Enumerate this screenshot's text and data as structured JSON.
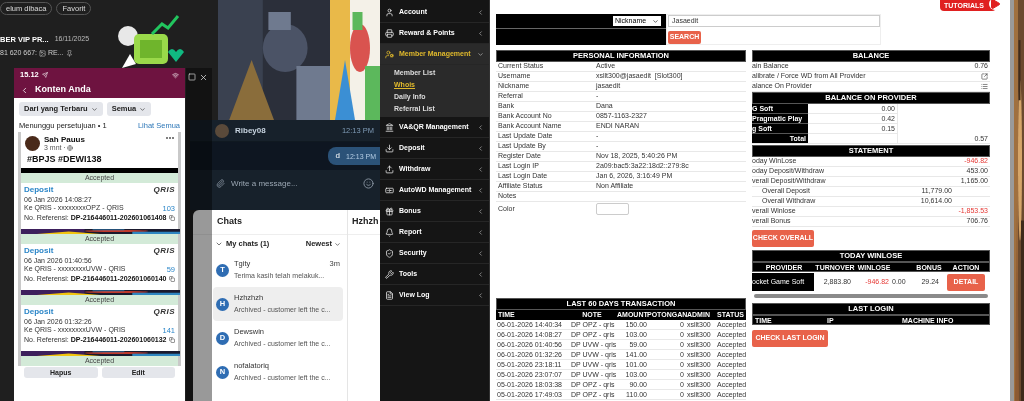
{
  "chat_list_fragment": {
    "chips": [
      "elum dibaca",
      "Favorit"
    ],
    "chat": {
      "name": "BER VIP PR...",
      "date": "16/11/2025",
      "preview_number": "81 620 667:",
      "preview_text": "RE..."
    }
  },
  "phone": {
    "time": "15.12",
    "title": "Konten Anda",
    "filters": [
      "Dari yang Terbaru",
      "Semua"
    ],
    "pending_label": "Menunggu persetujuan • 1",
    "see_all": "Lihat Semua",
    "post": {
      "author": "Sah Pauus",
      "age": "3 mnt ·",
      "text": "#BPJS #DEWI138"
    },
    "transactions": [
      {
        "status": "Accepted",
        "type": "Deposit",
        "logo": "QRIS",
        "date": "06 Jan 2026 14:08:27",
        "destination": "Ke QRIS - xxxxxxxxOPZ - QRIS",
        "amount": "103",
        "ref_label": "No. Referensi:",
        "ref": "DP-216446011-202601061408"
      },
      {
        "status": "Accepted",
        "type": "Deposit",
        "logo": "QRIS",
        "date": "06 Jan 2026 01:40:56",
        "destination": "Ke QRIS - xxxxxxxxUVW - QRIS",
        "amount": "59",
        "ref_label": "No. Referensi:",
        "ref": "DP-216446011-202601060140"
      },
      {
        "status": "Accepted",
        "type": "Deposit",
        "logo": "QRIS",
        "date": "06 Jan 2026 01:32:26",
        "destination": "Ke QRIS - xxxxxxxxUVW - QRIS",
        "amount": "141",
        "ref_label": "No. Referensi:",
        "ref": "DP-216446011-202601060132"
      }
    ],
    "last_status": "Accepted",
    "buttons": [
      "Hapus",
      "Edit"
    ]
  },
  "messenger": {
    "contact": "Ribey08",
    "time": "12:13 PM",
    "message": {
      "text": "d",
      "time": "12:13 PM"
    },
    "placeholder": "Write a message..."
  },
  "chats": {
    "title": "Chats",
    "section": "My chats (1)",
    "sort": "Newest",
    "open_chat": "Hzhzh",
    "items": [
      {
        "initial": "T",
        "name": "Tgity",
        "time": "3m",
        "preview": "Terima kasih telah melakuk...",
        "selected": false
      },
      {
        "initial": "H",
        "name": "Hzhzhzh",
        "preview": "Archived - customer left the c...",
        "selected": true
      },
      {
        "initial": "D",
        "name": "Dewswin",
        "preview": "Archived - customer left the c...",
        "selected": false
      },
      {
        "initial": "N",
        "name": "nofalatoriq",
        "preview": "Archived - customer left the c...",
        "selected": false
      }
    ]
  },
  "sidebar": {
    "items": [
      {
        "label": "Account",
        "expanded": false
      },
      {
        "label": "Reward & Points",
        "expanded": false
      },
      {
        "label": "Member Management",
        "expanded": true,
        "children": [
          {
            "label": "Member List",
            "selected": false
          },
          {
            "label": "Whois",
            "selected": true
          },
          {
            "label": "Daily Info",
            "selected": false
          },
          {
            "label": "Referral List",
            "selected": false
          }
        ]
      },
      {
        "label": "VA&QR Management",
        "expanded": false
      },
      {
        "label": "Deposit",
        "expanded": false
      },
      {
        "label": "Withdraw",
        "expanded": false
      },
      {
        "label": "AutoWD Management",
        "expanded": false
      },
      {
        "label": "Bonus",
        "expanded": false
      },
      {
        "label": "Report",
        "expanded": false
      },
      {
        "label": "Security",
        "expanded": false
      },
      {
        "label": "Tools",
        "expanded": false
      },
      {
        "label": "View Log",
        "expanded": false
      }
    ]
  },
  "tutorials_logo": "TUTORIALS",
  "search": {
    "field": "Nickname",
    "value": "Jasaedit",
    "button": "SEARCH"
  },
  "personal_information": {
    "title": "PERSONAL INFORMATION",
    "rows": [
      {
        "label": "Current Status",
        "value": "Active"
      },
      {
        "label": "Username",
        "value": "xsllt300@jasaedit  [Slot300]"
      },
      {
        "label": "Nickname",
        "value": "jasaedit"
      },
      {
        "label": "Referral",
        "value": "-"
      },
      {
        "label": "Bank",
        "value": "Dana"
      },
      {
        "label": "Bank Account No",
        "value": "0857-1163-2327"
      },
      {
        "label": "Bank Account Name",
        "value": "ENDI NARAN"
      },
      {
        "label": "Last Update Date",
        "value": "-"
      },
      {
        "label": "Last Update By",
        "value": "-"
      },
      {
        "label": "Register Date",
        "value": "Nov 18, 2025, 5:40:26 PM"
      },
      {
        "label": "Last Login IP",
        "value": "2a09:bac5:3a22:18d2::279:8c"
      },
      {
        "label": "Last Login Date",
        "value": "Jan 6, 2026, 3:16:49 PM"
      },
      {
        "label": "Affiliate Status",
        "value": "Non Affiliate"
      },
      {
        "label": "Notes"
      }
    ],
    "color_label": "Color"
  },
  "transactions": {
    "title": "LAST 60 DAYS TRANSACTION",
    "columns": [
      "TIME",
      "NOTE",
      "AMOUNT",
      "POTONGAN",
      "ADMIN",
      "STATUS"
    ],
    "rows": [
      [
        "06-01-2026 14:40:34",
        "DP OPZ - qris",
        "150.00",
        "0",
        "xsllt300",
        "Accepted"
      ],
      [
        "06-01-2026 14:08:27",
        "DP OPZ - qris",
        "103.00",
        "0",
        "xsllt300",
        "Accepted"
      ],
      [
        "06-01-2026 01:40:56",
        "DP UVW - qris",
        "59.00",
        "0",
        "xsllt300",
        "Accepted"
      ],
      [
        "06-01-2026 01:32:26",
        "DP UVW - qris",
        "141.00",
        "0",
        "xsllt300",
        "Accepted"
      ],
      [
        "05-01-2026 23:18:11",
        "DP UVW - qris",
        "101.00",
        "0",
        "xsllt300",
        "Accepted"
      ],
      [
        "05-01-2026 23:07:07",
        "DP UVW - qris",
        "103.00",
        "0",
        "xsllt300",
        "Accepted"
      ],
      [
        "05-01-2026 18:03:38",
        "DP OPZ - qris",
        "90.00",
        "0",
        "xsllt300",
        "Accepted"
      ],
      [
        "05-01-2026 17:49:03",
        "DP OPZ - qris",
        "110.00",
        "0",
        "xsllt300",
        "Accepted"
      ]
    ]
  },
  "balance": {
    "title": "BALANCE",
    "rows": [
      {
        "kind": "value",
        "label": "ain Balance",
        "value": "0.76"
      },
      {
        "kind": "export",
        "label": "alibrate / Force WD from All Provider"
      },
      {
        "kind": "list",
        "label": "alance On Provider"
      }
    ]
  },
  "balance_on_provider": {
    "title": "BALANCE ON PROVIDER",
    "rows": [
      {
        "name": "G Soft",
        "value": "0.00"
      },
      {
        "name": "Pragmatic Play",
        "value": "0.42"
      },
      {
        "name": "g Soft",
        "value": "0.15"
      }
    ],
    "total_label": "Total",
    "total": "0.57"
  },
  "statement": {
    "title": "STATEMENT",
    "rows": [
      {
        "kind": "main",
        "label": "oday WinLose",
        "value": "-946.82",
        "negative": true
      },
      {
        "kind": "main",
        "label": "oday Deposit/Withdraw",
        "value": "453.00",
        "negative": false
      },
      {
        "kind": "main",
        "label": "verall Deposit/Withdraw",
        "value": "1,165.00",
        "negative": false
      },
      {
        "kind": "sub",
        "label": "Overall Deposit",
        "value": "11,779.00",
        "negative": false
      },
      {
        "kind": "sub",
        "label": "Overall Withdraw",
        "value": "10,614.00",
        "negative": false
      },
      {
        "kind": "main",
        "label": "verall Winlose",
        "value": "-1,853.53",
        "negative": true
      },
      {
        "kind": "main",
        "label": "verall Bonus",
        "value": "706.76",
        "negative": false
      }
    ],
    "button": "CHECK OVERALL"
  },
  "today_winlose": {
    "title": "TODAY WINLOSE",
    "columns": [
      "PROVIDER",
      "TURNOVER",
      "WINLOSE",
      "BONUS",
      "ACTION"
    ],
    "row": {
      "provider": "ocket Game Soft",
      "turnover": "2,883.80",
      "winlose": "-946.82",
      "column_4": "0.00",
      "bonus": "29.24",
      "action": "DETAIL"
    }
  },
  "last_login": {
    "title": "LAST LOGIN",
    "columns": [
      "TIME",
      "IP",
      "MACHINE INFO"
    ],
    "button": "CHECK LAST LOGIN"
  }
}
